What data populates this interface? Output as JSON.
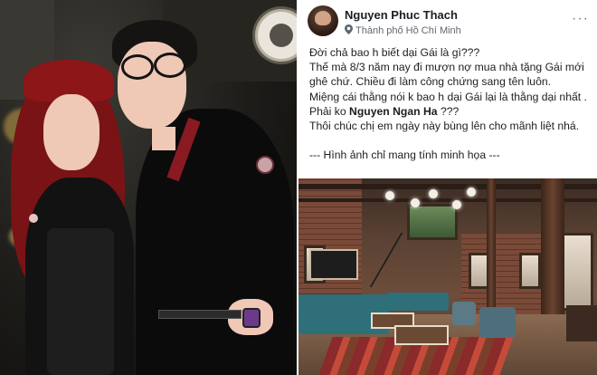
{
  "post": {
    "author": "Nguyen Phuc Thach",
    "location": "Thành phố Hồ Chí Minh",
    "line1": "Đời chả bao h biết dại Gái là gì???",
    "line2": "Thế mà 8/3 năm nay đi mượn nợ mua nhà tặng Gái mới ghê chứ. Chiều đi làm công chứng sang tên luôn.",
    "line3_pre": "Miệng cái thằng nói k bao h dại Gái lại là thằng dại nhất . Phải ko ",
    "mention": "Nguyen Ngan Ha",
    "line3_post": " ???",
    "line4": "Thôi chúc chị em ngày này bùng lên cho mãnh liệt nhá.",
    "caption": "--- Hình ảnh chỉ mang tính minh họa ---"
  },
  "icons": {
    "location": "location-pin-icon",
    "menu": "more-options-icon"
  },
  "colors": {
    "text": "#1c1e21",
    "secondary": "#606770",
    "hair": "#7a1315"
  }
}
